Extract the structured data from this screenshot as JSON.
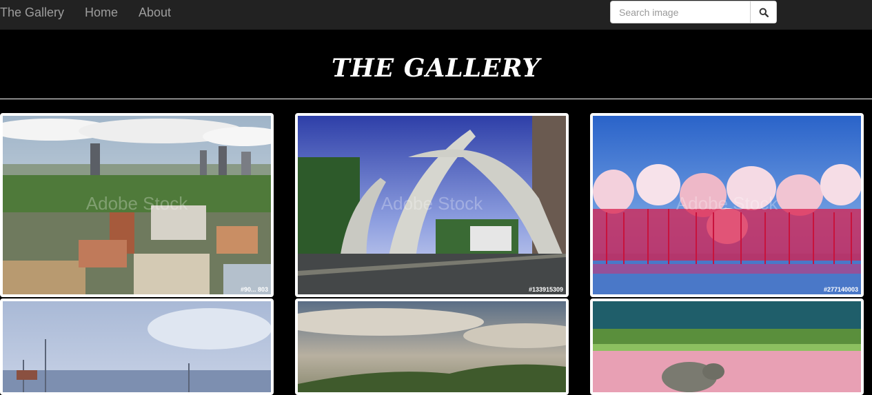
{
  "navbar": {
    "brand": "The Gallery",
    "links": [
      "Home",
      "About"
    ],
    "search_placeholder": "Search image",
    "search_icon": "search-icon"
  },
  "banner": {
    "title": "THE GALLERY"
  },
  "gallery": {
    "images": [
      {
        "subject": "nairobi-city-skyline",
        "watermark": "Adobe Stock",
        "stock_id": "#90... 803"
      },
      {
        "subject": "mombasa-tusks-arch",
        "watermark": "Adobe Stock",
        "stock_id": "#133915309"
      },
      {
        "subject": "pink-flamingos",
        "watermark": "Adobe Stock",
        "stock_id": "#277140003"
      },
      {
        "subject": "coastal-sky",
        "watermark": "",
        "stock_id": ""
      },
      {
        "subject": "savanna-landscape",
        "watermark": "",
        "stock_id": ""
      },
      {
        "subject": "rhino-flamingo-lake",
        "watermark": "",
        "stock_id": ""
      }
    ]
  }
}
